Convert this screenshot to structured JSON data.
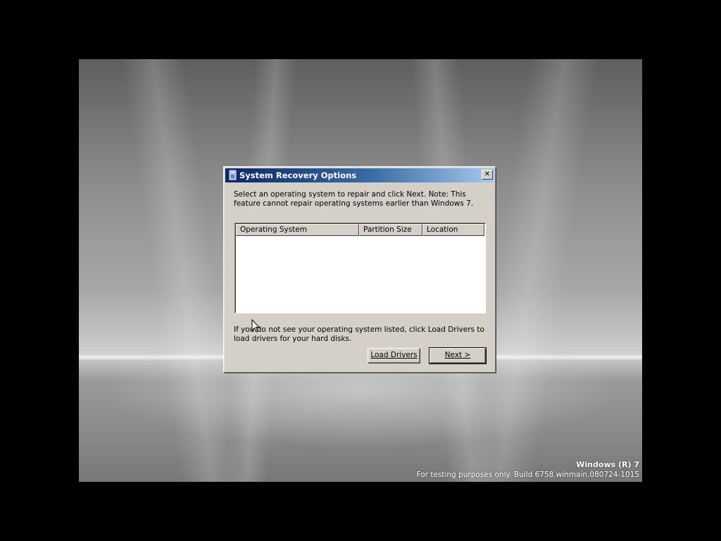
{
  "dialog": {
    "title": "System Recovery Options",
    "close_glyph": "✕",
    "intro_text": "Select an operating system to repair and click Next. Note: This feature cannot repair operating systems earlier than Windows 7.",
    "columns": [
      "Operating System",
      "Partition Size",
      "Location"
    ],
    "rows": [],
    "hint_text": "If you do not see your operating system listed, click Load Drivers to load drivers for your hard disks.",
    "load_drivers_label": "Load Drivers",
    "next_label": "Next >"
  },
  "desktop": {
    "product_name": "Windows (R) 7",
    "build_text": "For testing purposes only. Build 6758.winmain.080724-1015"
  },
  "icons": {
    "title_icon": "recovery-disk-icon",
    "cursor": "mouse-pointer-icon"
  },
  "colors": {
    "title_gradient_start": "#0a246a",
    "title_gradient_end": "#a6caf0",
    "dialog_face": "#d4d0c8",
    "list_background": "#ffffff",
    "screen_border": "#000000"
  }
}
